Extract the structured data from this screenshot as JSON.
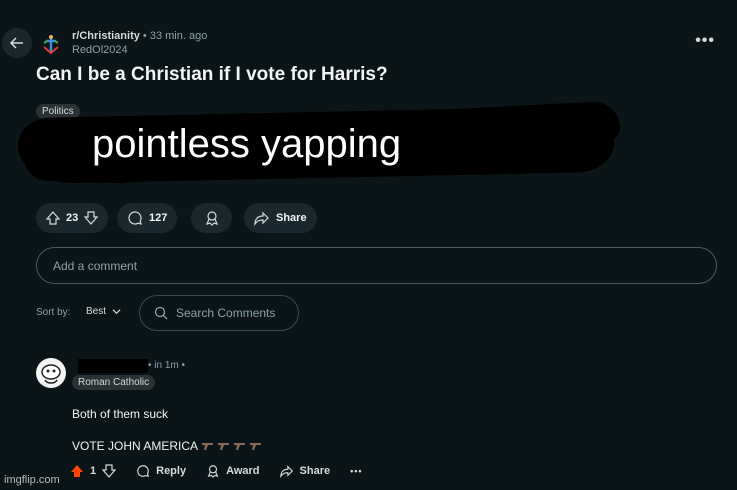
{
  "post": {
    "subreddit": "r/Christianity",
    "time": "• 33 min. ago",
    "author": "RedOl2024",
    "title": "Can I be a Christian if I vote for Harris?",
    "flair": "Politics",
    "overlay_text": "pointless yapping",
    "votes": "23",
    "comments": "127",
    "share_label": "Share"
  },
  "comment_box": {
    "placeholder": "Add a comment"
  },
  "sort": {
    "label": "Sort by:",
    "value": "Best"
  },
  "search_comments": {
    "placeholder": "Search Comments"
  },
  "comment": {
    "time": "• in 1m •",
    "flair": "Roman Catholic",
    "line1": "Both of them suck",
    "line2": "VOTE JOHN AMERICA",
    "votes": "1",
    "reply_label": "Reply",
    "award_label": "Award",
    "share_label": "Share",
    "more": "•••"
  },
  "watermark": "imgflip.com",
  "colors": {
    "upvote_active": "#ff4500",
    "background": "#0b1416"
  }
}
